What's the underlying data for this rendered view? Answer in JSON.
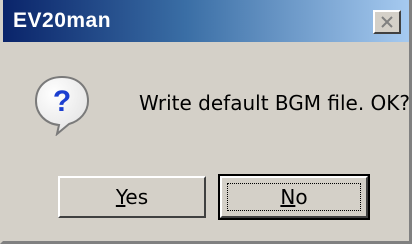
{
  "window": {
    "title": "EV20man",
    "close_icon": "close-x-icon"
  },
  "dialog": {
    "icon": "question-icon",
    "icon_glyph": "?",
    "message": "Write default BGM file. OK?"
  },
  "buttons": {
    "yes": {
      "mnemonic": "Y",
      "rest": "es"
    },
    "no": {
      "mnemonic": "N",
      "rest": "o",
      "focused": true
    }
  },
  "colors": {
    "titlebar_start": "#0a246a",
    "titlebar_end": "#a6caf0",
    "face": "#d4d0c8",
    "icon_fill": "#1c3fd0"
  }
}
